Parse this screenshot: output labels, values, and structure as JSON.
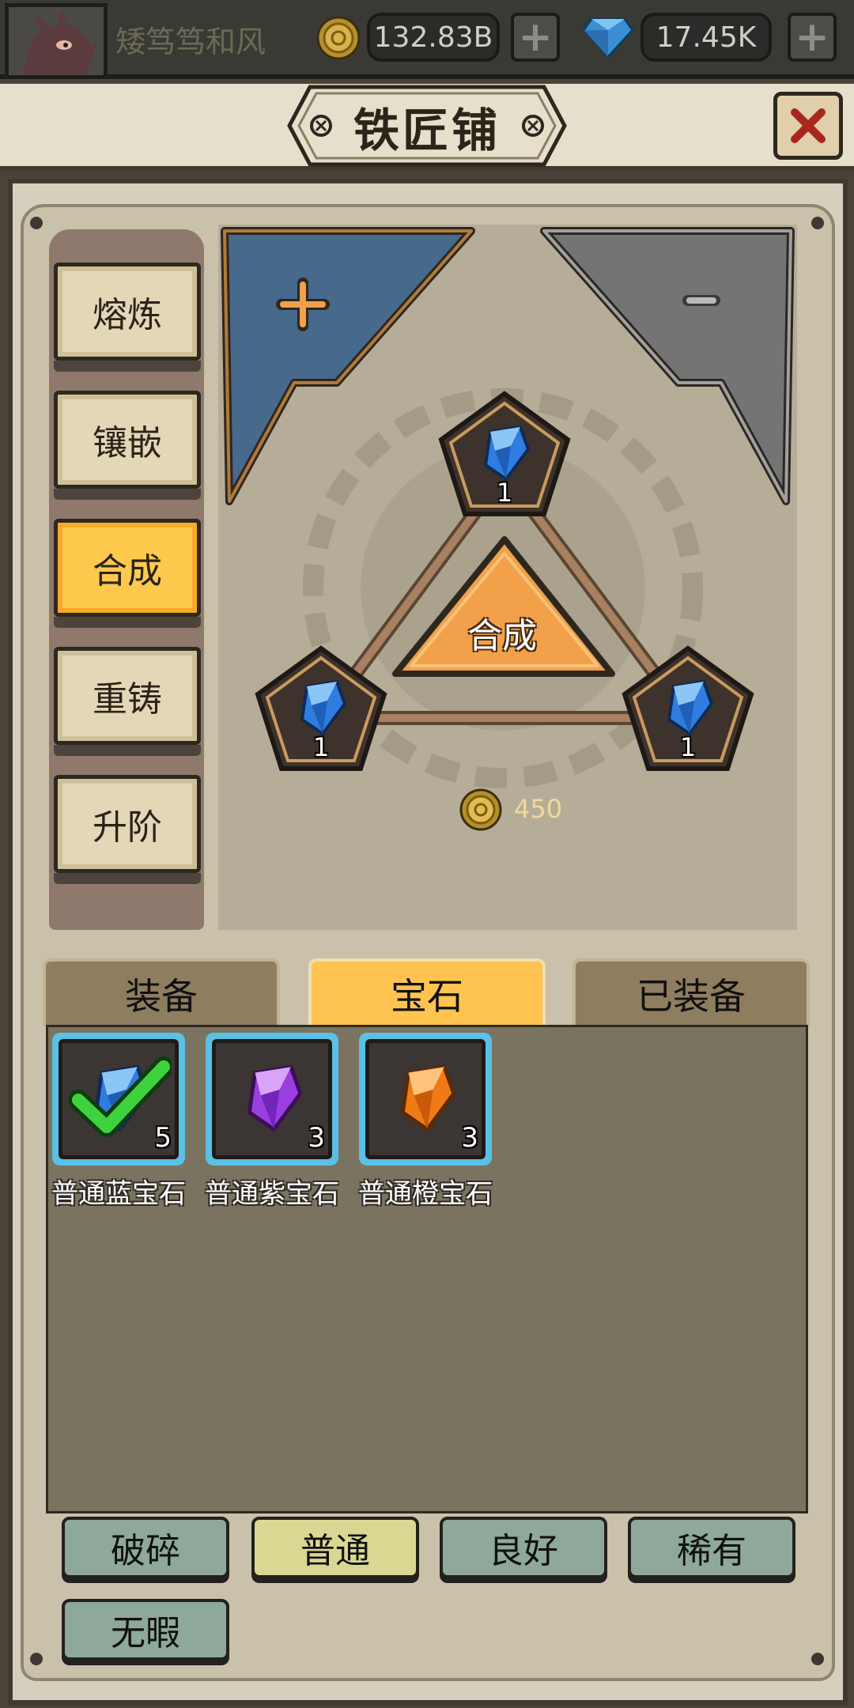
{
  "topbar": {
    "player_name": "矮笃笃和风",
    "gold_amount": "132.83B",
    "gem_amount": "17.45K",
    "add_symbol": "+"
  },
  "header": {
    "title": "铁匠铺"
  },
  "side_tabs": [
    {
      "label": "熔炼",
      "active": false
    },
    {
      "label": "镶嵌",
      "active": false
    },
    {
      "label": "合成",
      "active": true
    },
    {
      "label": "重铸",
      "active": false
    },
    {
      "label": "升阶",
      "active": false
    }
  ],
  "synthesis": {
    "add_symbol": "+",
    "remove_symbol": "-",
    "button_label": "合成",
    "slot_counts": [
      "1",
      "1",
      "1"
    ],
    "cost": "450"
  },
  "category_tabs": [
    {
      "label": "装备",
      "active": false
    },
    {
      "label": "宝石",
      "active": true
    },
    {
      "label": "已装备",
      "active": false
    }
  ],
  "inventory": {
    "items": [
      {
        "name": "普通蓝宝石",
        "count": "5",
        "color": "#2f7de0",
        "selected": true
      },
      {
        "name": "普通紫宝石",
        "count": "3",
        "color": "#9a3ee0",
        "selected": false
      },
      {
        "name": "普通橙宝石",
        "count": "3",
        "color": "#f07a16",
        "selected": false
      }
    ]
  },
  "quality_filters": [
    {
      "label": "破碎",
      "active": false
    },
    {
      "label": "普通",
      "active": true
    },
    {
      "label": "良好",
      "active": false
    },
    {
      "label": "稀有",
      "active": false
    },
    {
      "label": "无暇",
      "active": false
    }
  ],
  "colors": {
    "accent_gold": "#ffc44f",
    "slot_border": "#5bc0e6",
    "synth_orange": "#f2a14a"
  }
}
